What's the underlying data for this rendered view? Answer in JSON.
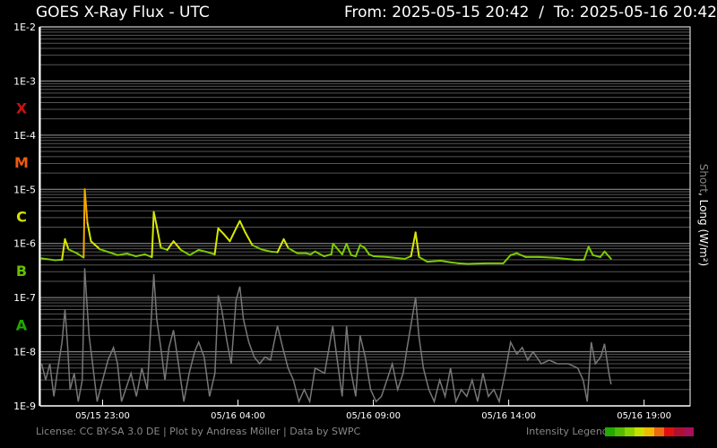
{
  "chart_data": {
    "type": "line",
    "title": "GOES X-Ray Flux - UTC",
    "range": {
      "from_label": "From:",
      "from": "2025-05-15 20:42",
      "separator": "/",
      "to_label": "To:",
      "to": "2025-05-16 20:42"
    },
    "ylabel_short": "Short",
    "ylabel_rest": ", Long (W/m²)",
    "y_scale": "log",
    "ylim": [
      1e-09,
      0.01
    ],
    "y_ticks": [
      "1E-2",
      "1E-3",
      "1E-4",
      "1E-5",
      "1E-6",
      "1E-7",
      "1E-8",
      "1E-9"
    ],
    "classes": [
      {
        "label": "X",
        "flux": 0.0001,
        "color": "#cc1010"
      },
      {
        "label": "M",
        "flux": 1e-05,
        "color": "#ee5a10"
      },
      {
        "label": "C",
        "flux": 1e-06,
        "color": "#d4e000"
      },
      {
        "label": "B",
        "flux": 1e-07,
        "color": "#66c000"
      },
      {
        "label": "A",
        "flux": 1e-08,
        "color": "#22a800"
      }
    ],
    "x_unit": "hours since 2025-05-15 20:42",
    "xlim": [
      0,
      24
    ],
    "x_ticks": [
      {
        "h": 2.3,
        "label": "05/15 23:00"
      },
      {
        "h": 7.3,
        "label": "05/16 04:00"
      },
      {
        "h": 12.3,
        "label": "05/16 09:00"
      },
      {
        "h": 17.3,
        "label": "05/16 14:00"
      },
      {
        "h": 22.3,
        "label": "05/16 19:00"
      }
    ],
    "grid": true,
    "series": [
      {
        "name": "Long",
        "points": [
          [
            0.05,
            5.3e-07
          ],
          [
            0.55,
            4.9e-07
          ],
          [
            0.8,
            5e-07
          ],
          [
            0.91,
            1.2e-06
          ],
          [
            1.04,
            7.8e-07
          ],
          [
            1.37,
            6.5e-07
          ],
          [
            1.6,
            5.5e-07
          ],
          [
            1.64,
            1e-05
          ],
          [
            1.74,
            2.4e-06
          ],
          [
            1.87,
            1.1e-06
          ],
          [
            2.2,
            7.8e-07
          ],
          [
            2.53,
            6.9e-07
          ],
          [
            2.86,
            6.1e-07
          ],
          [
            3.2,
            6.5e-07
          ],
          [
            3.53,
            5.8e-07
          ],
          [
            3.86,
            6.3e-07
          ],
          [
            4.12,
            5.6e-07
          ],
          [
            4.19,
            3.8e-06
          ],
          [
            4.29,
            2.2e-06
          ],
          [
            4.45,
            8.4e-07
          ],
          [
            4.69,
            7.6e-07
          ],
          [
            4.92,
            1.1e-06
          ],
          [
            5.19,
            7.6e-07
          ],
          [
            5.52,
            6.1e-07
          ],
          [
            5.85,
            7.6e-07
          ],
          [
            6.18,
            6.9e-07
          ],
          [
            6.44,
            6.3e-07
          ],
          [
            6.57,
            1.9e-06
          ],
          [
            6.77,
            1.5e-06
          ],
          [
            7.0,
            1.1e-06
          ],
          [
            7.23,
            1.9e-06
          ],
          [
            7.37,
            2.6e-06
          ],
          [
            7.57,
            1.6e-06
          ],
          [
            7.83,
            9.3e-07
          ],
          [
            8.16,
            7.8e-07
          ],
          [
            8.49,
            7.1e-07
          ],
          [
            8.76,
            6.9e-07
          ],
          [
            8.99,
            1.2e-06
          ],
          [
            9.16,
            8.2e-07
          ],
          [
            9.49,
            6.6e-07
          ],
          [
            9.82,
            6.6e-07
          ],
          [
            9.98,
            6.3e-07
          ],
          [
            10.15,
            7.1e-07
          ],
          [
            10.48,
            5.8e-07
          ],
          [
            10.75,
            6.3e-07
          ],
          [
            10.81,
            9.9e-07
          ],
          [
            10.98,
            7.9e-07
          ],
          [
            11.15,
            6.3e-07
          ],
          [
            11.31,
            9.9e-07
          ],
          [
            11.48,
            6.1e-07
          ],
          [
            11.65,
            5.8e-07
          ],
          [
            11.81,
            9.3e-07
          ],
          [
            11.98,
            8.3e-07
          ],
          [
            12.14,
            6.3e-07
          ],
          [
            12.31,
            5.8e-07
          ],
          [
            12.8,
            5.6e-07
          ],
          [
            13.46,
            5.2e-07
          ],
          [
            13.69,
            5.8e-07
          ],
          [
            13.86,
            1.6e-06
          ],
          [
            13.99,
            5.6e-07
          ],
          [
            14.29,
            4.6e-07
          ],
          [
            14.79,
            4.8e-07
          ],
          [
            15.12,
            4.5e-07
          ],
          [
            15.45,
            4.3e-07
          ],
          [
            15.78,
            4.2e-07
          ],
          [
            16.44,
            4.3e-07
          ],
          [
            17.1,
            4.3e-07
          ],
          [
            17.37,
            6.1e-07
          ],
          [
            17.6,
            6.6e-07
          ],
          [
            17.93,
            5.6e-07
          ],
          [
            18.43,
            5.6e-07
          ],
          [
            19.09,
            5.4e-07
          ],
          [
            19.75,
            5e-07
          ],
          [
            20.08,
            5e-07
          ],
          [
            20.25,
            8.7e-07
          ],
          [
            20.41,
            6.1e-07
          ],
          [
            20.68,
            5.6e-07
          ],
          [
            20.84,
            7.1e-07
          ],
          [
            21.08,
            5.2e-07
          ]
        ]
      },
      {
        "name": "Short",
        "points": [
          [
            0.05,
            6e-09
          ],
          [
            0.2,
            3e-09
          ],
          [
            0.35,
            6e-09
          ],
          [
            0.5,
            1.5e-09
          ],
          [
            0.65,
            5e-09
          ],
          [
            0.8,
            1.5e-08
          ],
          [
            0.91,
            6e-08
          ],
          [
            1.0,
            1.5e-08
          ],
          [
            1.1,
            2e-09
          ],
          [
            1.25,
            4e-09
          ],
          [
            1.4,
            1.2e-09
          ],
          [
            1.55,
            3e-09
          ],
          [
            1.64,
            3.5e-07
          ],
          [
            1.7,
            1.1e-07
          ],
          [
            1.8,
            2e-08
          ],
          [
            1.95,
            5e-09
          ],
          [
            2.1,
            1.2e-09
          ],
          [
            2.3,
            3e-09
          ],
          [
            2.5,
            7e-09
          ],
          [
            2.7,
            1.2e-08
          ],
          [
            2.85,
            6e-09
          ],
          [
            3.0,
            1.2e-09
          ],
          [
            3.15,
            2e-09
          ],
          [
            3.35,
            4e-09
          ],
          [
            3.55,
            1.5e-09
          ],
          [
            3.75,
            5e-09
          ],
          [
            3.95,
            2e-09
          ],
          [
            4.19,
            2.7e-07
          ],
          [
            4.3,
            4e-08
          ],
          [
            4.45,
            1.2e-08
          ],
          [
            4.6,
            3e-09
          ],
          [
            4.75,
            1.2e-08
          ],
          [
            4.92,
            2.5e-08
          ],
          [
            5.1,
            6e-09
          ],
          [
            5.3,
            1.2e-09
          ],
          [
            5.5,
            4e-09
          ],
          [
            5.7,
            1e-08
          ],
          [
            5.85,
            1.5e-08
          ],
          [
            6.05,
            8e-09
          ],
          [
            6.25,
            1.5e-09
          ],
          [
            6.45,
            4e-09
          ],
          [
            6.57,
            1.1e-07
          ],
          [
            6.7,
            6e-08
          ],
          [
            6.9,
            1.5e-08
          ],
          [
            7.05,
            6e-09
          ],
          [
            7.23,
            9e-08
          ],
          [
            7.37,
            1.6e-07
          ],
          [
            7.5,
            4e-08
          ],
          [
            7.7,
            1.5e-08
          ],
          [
            7.9,
            8e-09
          ],
          [
            8.1,
            6e-09
          ],
          [
            8.3,
            8e-09
          ],
          [
            8.5,
            7e-09
          ],
          [
            8.76,
            3e-08
          ],
          [
            8.95,
            1.2e-08
          ],
          [
            9.15,
            5e-09
          ],
          [
            9.35,
            3e-09
          ],
          [
            9.55,
            1.2e-09
          ],
          [
            9.75,
            2e-09
          ],
          [
            9.95,
            1.2e-09
          ],
          [
            10.15,
            5e-09
          ],
          [
            10.5,
            4e-09
          ],
          [
            10.8,
            3e-08
          ],
          [
            10.95,
            8e-09
          ],
          [
            11.15,
            1.5e-09
          ],
          [
            11.31,
            3e-08
          ],
          [
            11.45,
            5e-09
          ],
          [
            11.65,
            1.5e-09
          ],
          [
            11.81,
            2e-08
          ],
          [
            12.0,
            8e-09
          ],
          [
            12.2,
            2e-09
          ],
          [
            12.4,
            1.2e-09
          ],
          [
            12.6,
            1.5e-09
          ],
          [
            12.8,
            3e-09
          ],
          [
            13.0,
            6e-09
          ],
          [
            13.2,
            2e-09
          ],
          [
            13.4,
            4e-09
          ],
          [
            13.55,
            1.2e-08
          ],
          [
            13.86,
            1e-07
          ],
          [
            13.98,
            2e-08
          ],
          [
            14.15,
            5e-09
          ],
          [
            14.35,
            2e-09
          ],
          [
            14.55,
            1.2e-09
          ],
          [
            14.75,
            3e-09
          ],
          [
            14.95,
            1.5e-09
          ],
          [
            15.15,
            5e-09
          ],
          [
            15.35,
            1.2e-09
          ],
          [
            15.55,
            2e-09
          ],
          [
            15.75,
            1.5e-09
          ],
          [
            15.95,
            3e-09
          ],
          [
            16.15,
            1.2e-09
          ],
          [
            16.35,
            4e-09
          ],
          [
            16.55,
            1.5e-09
          ],
          [
            16.75,
            2e-09
          ],
          [
            16.95,
            1.2e-09
          ],
          [
            17.2,
            5e-09
          ],
          [
            17.37,
            1.5e-08
          ],
          [
            17.6,
            9e-09
          ],
          [
            17.8,
            1.2e-08
          ],
          [
            18.0,
            7e-09
          ],
          [
            18.2,
            1e-08
          ],
          [
            18.5,
            6e-09
          ],
          [
            18.8,
            7e-09
          ],
          [
            19.1,
            6e-09
          ],
          [
            19.5,
            6e-09
          ],
          [
            19.85,
            5e-09
          ],
          [
            20.05,
            3e-09
          ],
          [
            20.2,
            1.2e-09
          ],
          [
            20.35,
            1.5e-08
          ],
          [
            20.5,
            6e-09
          ],
          [
            20.7,
            8e-09
          ],
          [
            20.84,
            1.4e-08
          ],
          [
            21.0,
            4e-09
          ],
          [
            21.08,
            2.5e-09
          ]
        ]
      }
    ],
    "series_colors": {
      "short": "#777777",
      "long_b": "#7ccc00",
      "long_c": "#d8e800",
      "long_m": "#f2a800"
    }
  },
  "footer": "License: CC BY-SA 3.0 DE | Plot by Andreas Möller | Data by SWPC",
  "legend": {
    "label": "Intensity Legend",
    "colors": [
      "#22aa00",
      "#55bb00",
      "#88d400",
      "#c8e000",
      "#eebb00",
      "#ec6a10",
      "#e01010",
      "#b01030",
      "#a81058"
    ]
  }
}
